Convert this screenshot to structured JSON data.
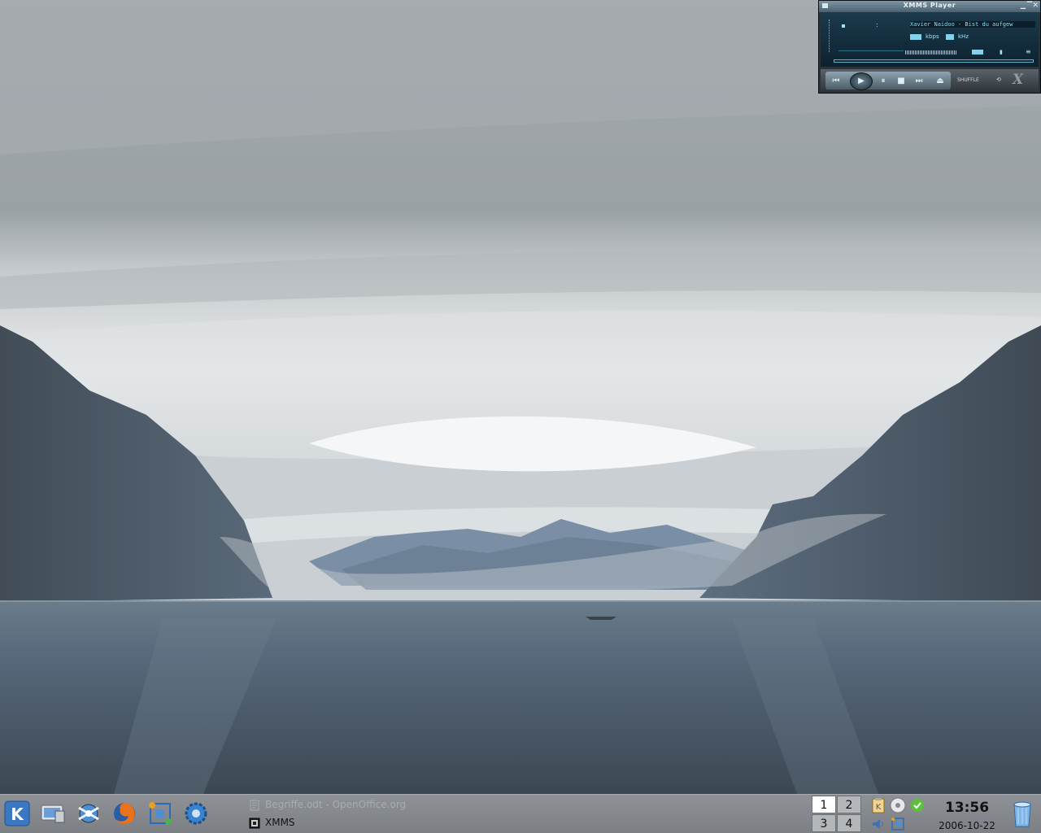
{
  "xmms": {
    "title": "XMMS Player",
    "song": "Xavier Naidoo - Bist du aufgew",
    "kbps_label": "kbps",
    "khz_label": "kHz",
    "shuffle_label": "SHUFFLE",
    "eq_label": "EQ",
    "logo_text": "X",
    "buttons": {
      "prev": "⏮",
      "play": "▶",
      "pause": "⏸",
      "stop": "■",
      "next": "⏭",
      "eject": "⏏"
    }
  },
  "taskbar": {
    "launchers": [
      "kde-menu-icon",
      "system-icon",
      "konqueror-icon",
      "firefox-icon",
      "network-icon",
      "settings-icon"
    ],
    "tasks": [
      {
        "label": "Begriffe.odt - OpenOffice.org",
        "icon": "openoffice-icon",
        "minimized": true
      },
      {
        "label": "XMMS",
        "icon": "xmms-icon",
        "minimized": false
      }
    ]
  },
  "pager": {
    "desktops": [
      "1",
      "2",
      "3",
      "4"
    ],
    "active": "1"
  },
  "tray": {
    "icons": [
      "klipper-icon",
      "kmix-cd-icon",
      "update-icon",
      "volume-icon",
      "network-tray-icon"
    ]
  },
  "clock": {
    "time": "13:56",
    "date": "2006-10-22"
  },
  "colors": {
    "sky": "#a3a9ad",
    "water": "#4d5d6b",
    "mountains": "#5a6775",
    "taskbar": "#868a8e",
    "xmms_display": "#7fd3ec"
  }
}
